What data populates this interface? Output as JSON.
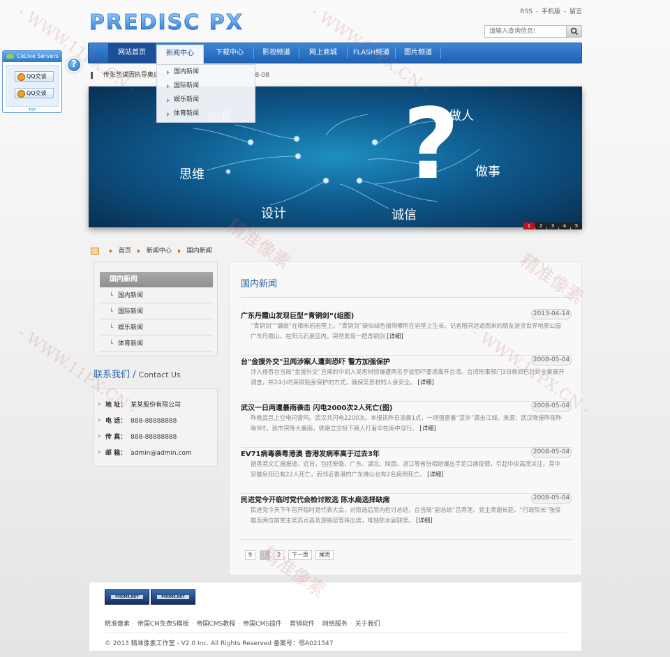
{
  "header": {
    "logo_text": "PREDISC PX",
    "top_links": [
      "RSS",
      "手机版",
      "留言"
    ],
    "search_placeholder": "请输入查询信息!"
  },
  "nav": {
    "items": [
      "网站首页",
      "新闻中心",
      "下载中心",
      "影视频道",
      "网上商城",
      "FLASH频道",
      "图片频道"
    ],
    "dropdown": [
      "国内新闻",
      "国际新闻",
      "娱乐新闻",
      "体育新闻"
    ]
  },
  "ticker": {
    "text": "传张艺谋因执导奥运",
    "date": "08-08"
  },
  "banner": {
    "words": [
      "创意",
      "做人",
      "思维",
      "做事",
      "设计",
      "诚信"
    ],
    "symbol": "?",
    "pages": [
      "1",
      "2",
      "3",
      "4",
      "5"
    ]
  },
  "breadcrumb": [
    "首页",
    "新闻中心",
    "国内新闻"
  ],
  "sidebar": {
    "header": "国内新闻",
    "items": [
      "国内新闻",
      "国际新闻",
      "娱乐新闻",
      "体育新闻"
    ]
  },
  "contact": {
    "title": "联系我们",
    "title_en": "Contact Us",
    "rows": [
      {
        "label": "地 址：",
        "value": "某某股份有限公司"
      },
      {
        "label": "电 话：",
        "value": "888-88888888"
      },
      {
        "label": "传 真：",
        "value": "888-88888888"
      },
      {
        "label": "邮 箱：",
        "value": "admin@admin.com"
      }
    ]
  },
  "main": {
    "title": "国内新闻",
    "more_label": "[详细]",
    "articles": [
      {
        "title": "广东丹霞山发现巨型“青铜剑”(组图)",
        "date": "2013-04-14",
        "desc": "“青铜剑”“镰嵌”在晒布岩岩壁上。“青铜剑”疑似绿色植物攀附在岩壁上生长。记者陪同远道而来的朋友游览世界地质公园广东丹霞山，在阳元石景区内，突然发现一把青铜剑"
      },
      {
        "title": "台\"金援外交\"丑闻涉案人遭到恐吓 警方加强保护",
        "date": "2008-05-04",
        "desc": "涉入侵吞台当局“金援外交”丑闻的中间人吴思材惊爆遭两名歹徒恐吓要求离开台湾。台湾刑事部门3日晚间已针对全案展开调查，并24小时采取贴身保护的方式，确保吴思材的人身安全。"
      },
      {
        "title": "武汉一日两遭暴雨袭击 闪电2000次2人死亡(图)",
        "date": "2008-05-04",
        "desc": "昨晚武昌上空电闪雷鸣。武汉共闪电2200次。本报讯昨日凌晨1点，一场强雷暴“意外”袭击江城。来源：武汉晚报昨夜昨晚9时，我市突降大暴雨，铁路立交桥下路人打着伞在雨中穿行。"
      },
      {
        "title": "EV71病毒袭粤港澳 香港发病率高于过去3年",
        "date": "2008-05-04",
        "desc": "据香港文汇报报道，近日，包括安徽、广东、湖北、陕西、浙江等省份相继爆出手足口病疫情，引起中央高度关注。其中安徽阜阳已有22人死亡，而邻近香港的广东佛山也有2名病例死亡。"
      },
      {
        "title": "民进党今开临时党代会检讨败选 陈水扁选择缺席",
        "date": "2008-05-04",
        "desc": "民进党今天下午召开临时党代表大会，对败选后党内检讨总结，台当局“副总统”吕秀莲、党主席谢长廷、“行政院长”张俊雄及两位前党主席苏贞昌及游锡堃等将出席，唯独陈水扁缺席。"
      }
    ],
    "pagination": [
      "9",
      "1",
      "2",
      "下一页",
      "尾页"
    ]
  },
  "footer": {
    "badges": [
      "PHOME.NET",
      "PHOME.NET"
    ],
    "links": [
      "精准像素",
      "帝国CM免费S模板",
      "帝国CMS教程",
      "帝国CMS插件",
      "营销软件",
      "网络服务",
      "关于我们"
    ],
    "copyright": "© 2013 精准像素工作室 - V2.0 Inc. All Rights Reserved 备案号：鄂A021547"
  },
  "qq": {
    "title": "CeLive Servers",
    "buttons": [
      "QQ交谈",
      "QQ交谈"
    ],
    "top": "TOP"
  },
  "help_symbol": "?",
  "watermarks": [
    "- WWW.11PX.CN -",
    "- WWW.11PX.CN -",
    "- WWW.11PX.CN -",
    "- WWW.11PX.CN -",
    "精准像素",
    "精准像素",
    "精准像素"
  ]
}
